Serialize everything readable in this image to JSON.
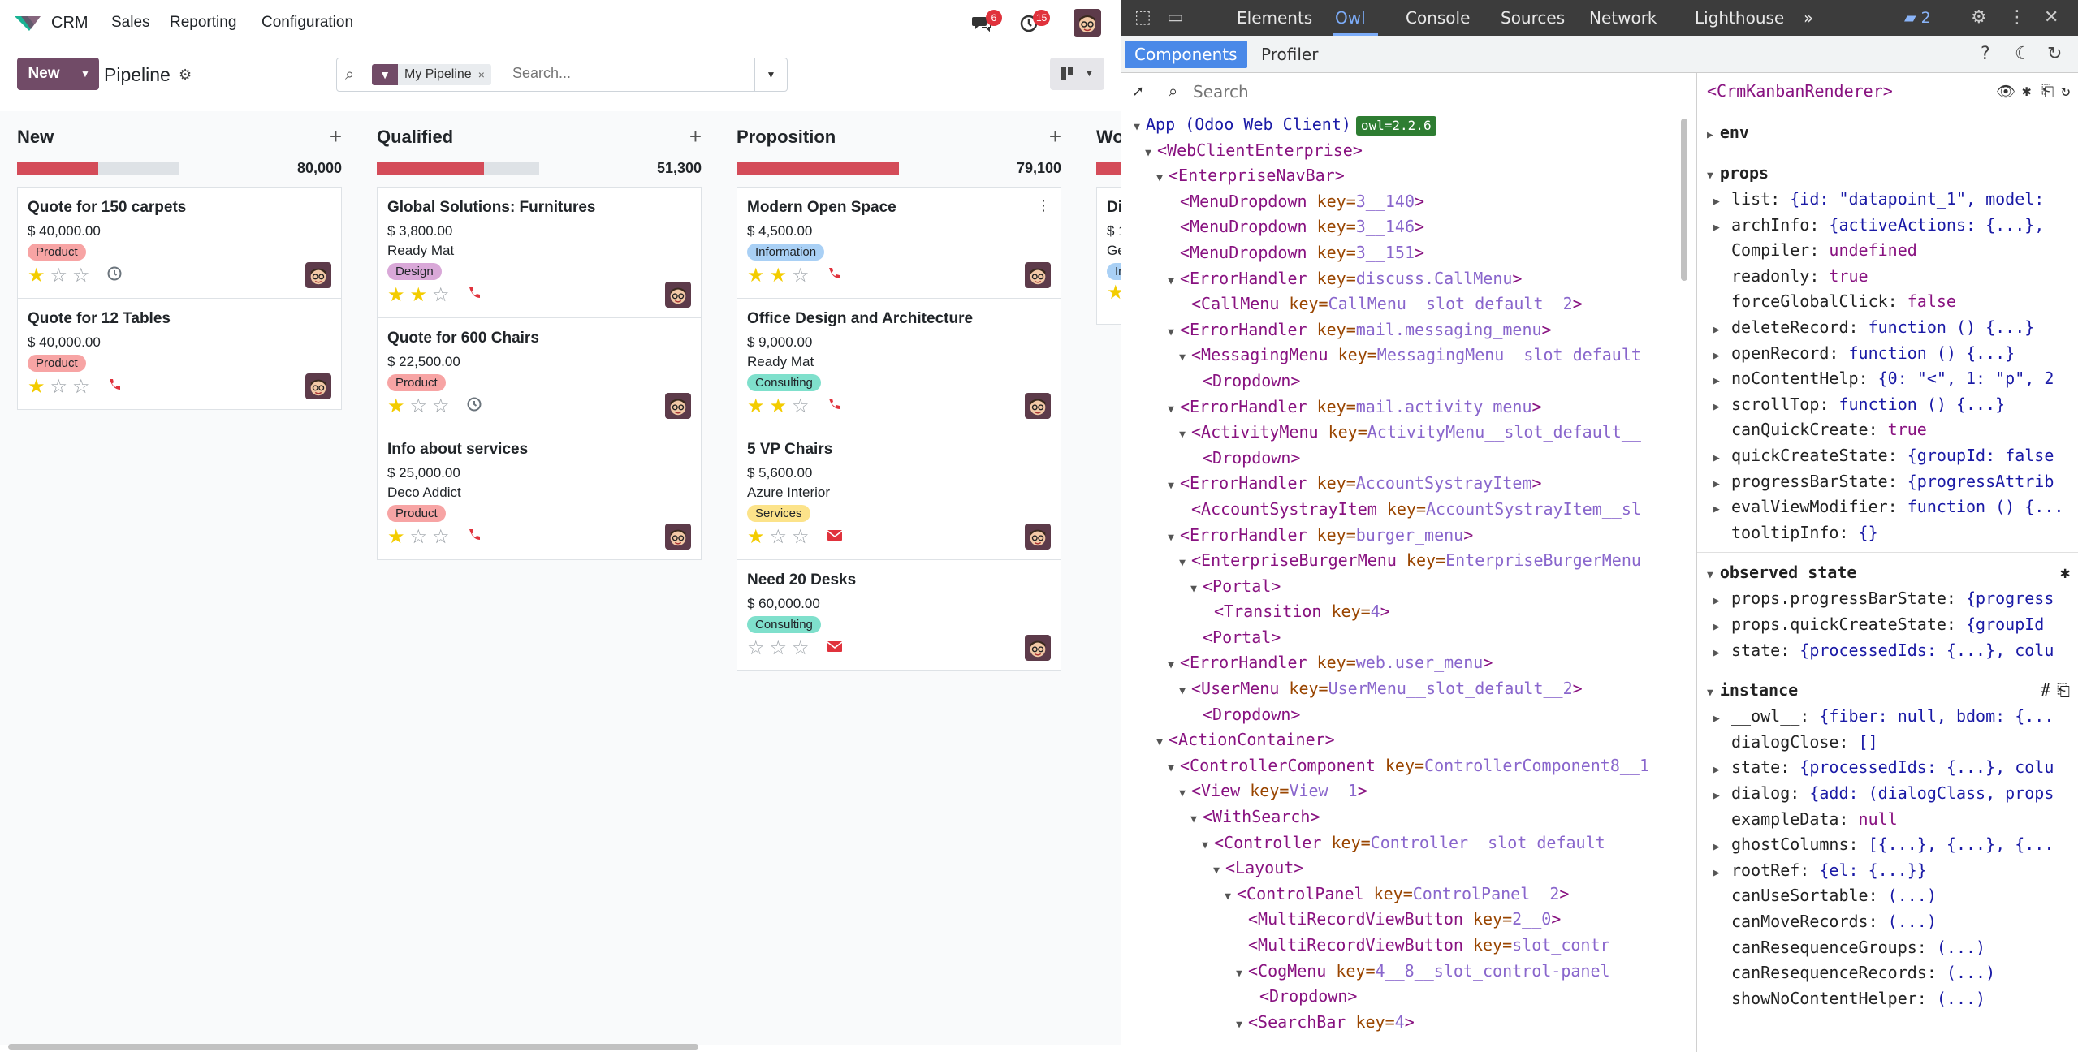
{
  "crm": {
    "app_name": "CRM",
    "menu": [
      "Sales",
      "Reporting",
      "Configuration"
    ],
    "discuss_count": "6",
    "activity_count": "15",
    "new_label": "New",
    "breadcrumb": "Pipeline",
    "facet_label": "My Pipeline",
    "search_placeholder": "Search...",
    "columns": [
      {
        "title": "New",
        "total": "80,000",
        "progress": 0.5,
        "cards": [
          {
            "name": "Quote for 150 carpets",
            "amount": "$ 40,000.00",
            "company": "",
            "tag": "Product",
            "tag_color": "#f7a4a4",
            "stars": 1,
            "activity": "clock"
          },
          {
            "name": "Quote for 12 Tables",
            "amount": "$ 40,000.00",
            "company": "",
            "tag": "Product",
            "tag_color": "#f7a4a4",
            "stars": 1,
            "activity": "phone"
          }
        ]
      },
      {
        "title": "Qualified",
        "total": "51,300",
        "progress": 0.66,
        "cards": [
          {
            "name": "Global Solutions: Furnitures",
            "amount": "$ 3,800.00",
            "company": "Ready Mat",
            "tag": "Design",
            "tag_color": "#d9a8d8",
            "stars": 2,
            "activity": "phone"
          },
          {
            "name": "Quote for 600 Chairs",
            "amount": "$ 22,500.00",
            "company": "",
            "tag": "Product",
            "tag_color": "#f7a4a4",
            "stars": 1,
            "activity": "clock"
          },
          {
            "name": "Info about services",
            "amount": "$ 25,000.00",
            "company": "Deco Addict",
            "tag": "Product",
            "tag_color": "#f7a4a4",
            "stars": 1,
            "activity": "phone"
          }
        ]
      },
      {
        "title": "Proposition",
        "total": "79,100",
        "progress": 1.0,
        "cards": [
          {
            "name": "Modern Open Space",
            "amount": "$ 4,500.00",
            "company": "",
            "tag": "Information",
            "tag_color": "#a9d0f5",
            "stars": 2,
            "activity": "phone"
          },
          {
            "name": "Office Design and Architecture",
            "amount": "$ 9,000.00",
            "company": "Ready Mat",
            "tag": "Consulting",
            "tag_color": "#7fe0cc",
            "stars": 2,
            "activity": "phone"
          },
          {
            "name": "5 VP Chairs",
            "amount": "$ 5,600.00",
            "company": "Azure Interior",
            "tag": "Services",
            "tag_color": "#fce38a",
            "stars": 1,
            "activity": "email"
          },
          {
            "name": "Need 20 Desks",
            "amount": "$ 60,000.00",
            "company": "",
            "tag": "Consulting",
            "tag_color": "#7fe0cc",
            "stars": 0,
            "activity": "email"
          }
        ]
      }
    ],
    "partial_column": {
      "title": "Wo",
      "name": "Di",
      "amount": "$ 1",
      "company": "Ge",
      "tag": "In"
    }
  },
  "devtools": {
    "tabs": [
      "Elements",
      "Owl",
      "Console",
      "Sources",
      "Network",
      "Lighthouse"
    ],
    "active_tab": "Owl",
    "more": "»",
    "message_count": "2",
    "subtabs": [
      "Components",
      "Profiler"
    ],
    "search_placeholder": "Search",
    "tree": [
      {
        "indent": 0,
        "arrow": "▼",
        "name": "App (Odoo Web Client)",
        "key": "",
        "val": "",
        "owl": "owl=2.2.6",
        "plain": true
      },
      {
        "indent": 1,
        "arrow": "▼",
        "name": "<WebClientEnterprise>",
        "key": "",
        "val": ""
      },
      {
        "indent": 2,
        "arrow": "▼",
        "name": "<EnterpriseNavBar>",
        "key": "",
        "val": ""
      },
      {
        "indent": 3,
        "arrow": "",
        "name": "<MenuDropdown",
        "key": " key=",
        "val": "3__140",
        "close": ">"
      },
      {
        "indent": 3,
        "arrow": "",
        "name": "<MenuDropdown",
        "key": " key=",
        "val": "3__146",
        "close": ">"
      },
      {
        "indent": 3,
        "arrow": "",
        "name": "<MenuDropdown",
        "key": " key=",
        "val": "3__151",
        "close": ">"
      },
      {
        "indent": 3,
        "arrow": "▼",
        "name": "<ErrorHandler",
        "key": " key=",
        "val": "discuss.CallMenu",
        "close": ">"
      },
      {
        "indent": 4,
        "arrow": "",
        "name": "<CallMenu",
        "key": " key=",
        "val": "CallMenu__slot_default__2",
        "close": ">"
      },
      {
        "indent": 3,
        "arrow": "▼",
        "name": "<ErrorHandler",
        "key": " key=",
        "val": "mail.messaging_menu",
        "close": ">"
      },
      {
        "indent": 4,
        "arrow": "▼",
        "name": "<MessagingMenu",
        "key": " key=",
        "val": "MessagingMenu__slot_default",
        "close": ""
      },
      {
        "indent": 5,
        "arrow": "",
        "name": "<Dropdown>",
        "key": "",
        "val": ""
      },
      {
        "indent": 3,
        "arrow": "▼",
        "name": "<ErrorHandler",
        "key": " key=",
        "val": "mail.activity_menu",
        "close": ">"
      },
      {
        "indent": 4,
        "arrow": "▼",
        "name": "<ActivityMenu",
        "key": " key=",
        "val": "ActivityMenu__slot_default__",
        "close": ""
      },
      {
        "indent": 5,
        "arrow": "",
        "name": "<Dropdown>",
        "key": "",
        "val": ""
      },
      {
        "indent": 3,
        "arrow": "▼",
        "name": "<ErrorHandler",
        "key": " key=",
        "val": "AccountSystrayItem",
        "close": ">"
      },
      {
        "indent": 4,
        "arrow": "",
        "name": "<AccountSystrayItem",
        "key": " key=",
        "val": "AccountSystrayItem__sl",
        "close": ""
      },
      {
        "indent": 3,
        "arrow": "▼",
        "name": "<ErrorHandler",
        "key": " key=",
        "val": "burger_menu",
        "close": ">"
      },
      {
        "indent": 4,
        "arrow": "▼",
        "name": "<EnterpriseBurgerMenu",
        "key": " key=",
        "val": "EnterpriseBurgerMenu",
        "close": ""
      },
      {
        "indent": 5,
        "arrow": "▼",
        "name": "<Portal>",
        "key": "",
        "val": ""
      },
      {
        "indent": 6,
        "arrow": "",
        "name": "<Transition",
        "key": " key=",
        "val": "4",
        "close": ">"
      },
      {
        "indent": 5,
        "arrow": "",
        "name": "<Portal>",
        "key": "",
        "val": ""
      },
      {
        "indent": 3,
        "arrow": "▼",
        "name": "<ErrorHandler",
        "key": " key=",
        "val": "web.user_menu",
        "close": ">"
      },
      {
        "indent": 4,
        "arrow": "▼",
        "name": "<UserMenu",
        "key": " key=",
        "val": "UserMenu__slot_default__2",
        "close": ">"
      },
      {
        "indent": 5,
        "arrow": "",
        "name": "<Dropdown>",
        "key": "",
        "val": ""
      },
      {
        "indent": 2,
        "arrow": "▼",
        "name": "<ActionContainer>",
        "key": "",
        "val": ""
      },
      {
        "indent": 3,
        "arrow": "▼",
        "name": "<ControllerComponent",
        "key": " key=",
        "val": "ControllerComponent8__1",
        "close": ""
      },
      {
        "indent": 4,
        "arrow": "▼",
        "name": "<View",
        "key": " key=",
        "val": "View__1",
        "close": ">"
      },
      {
        "indent": 5,
        "arrow": "▼",
        "name": "<WithSearch>",
        "key": "",
        "val": ""
      },
      {
        "indent": 6,
        "arrow": "▼",
        "name": "<Controller",
        "key": " key=",
        "val": "Controller__slot_default__",
        "close": ""
      },
      {
        "indent": 7,
        "arrow": "▼",
        "name": "<Layout>",
        "key": "",
        "val": ""
      },
      {
        "indent": 8,
        "arrow": "▼",
        "name": "<ControlPanel",
        "key": " key=",
        "val": "ControlPanel__2",
        "close": ">"
      },
      {
        "indent": 9,
        "arrow": "",
        "name": "<MultiRecordViewButton",
        "key": " key=",
        "val": "2__0",
        "close": ">"
      },
      {
        "indent": 9,
        "arrow": "",
        "name": "<MultiRecordViewButton",
        "key": " key=",
        "val": "slot_contr",
        "close": ""
      },
      {
        "indent": 9,
        "arrow": "▼",
        "name": "<CogMenu",
        "key": " key=",
        "val": "4__8__slot_control-panel",
        "close": ""
      },
      {
        "indent": 10,
        "arrow": "",
        "name": "<Dropdown>",
        "key": "",
        "val": ""
      },
      {
        "indent": 9,
        "arrow": "▼",
        "name": "<SearchBar",
        "key": " key=",
        "val": "4",
        "close": ">"
      }
    ],
    "props_component": "<CrmKanbanRenderer>",
    "sections": [
      {
        "title": "env",
        "open": false,
        "rows": []
      },
      {
        "title": "props",
        "open": true,
        "rows": [
          {
            "arrow": true,
            "key": "list:",
            "val": "{id: \"datapoint_1\", model:",
            "kw": false
          },
          {
            "arrow": true,
            "key": "archInfo:",
            "val": "{activeActions: {...},",
            "kw": false
          },
          {
            "arrow": false,
            "key": "Compiler:",
            "val": "undefined",
            "kw": true
          },
          {
            "arrow": false,
            "key": "readonly:",
            "val": "true",
            "kw": true
          },
          {
            "arrow": false,
            "key": "forceGlobalClick:",
            "val": "false",
            "kw": true
          },
          {
            "arrow": true,
            "key": "deleteRecord:",
            "val": "function () {...}",
            "kw": false
          },
          {
            "arrow": true,
            "key": "openRecord:",
            "val": "function () {...}",
            "kw": false
          },
          {
            "arrow": true,
            "key": "noContentHelp:",
            "val": "{0: \"<\", 1: \"p\", 2",
            "kw": false
          },
          {
            "arrow": true,
            "key": "scrollTop:",
            "val": "function () {...}",
            "kw": false
          },
          {
            "arrow": false,
            "key": "canQuickCreate:",
            "val": "true",
            "kw": true
          },
          {
            "arrow": true,
            "key": "quickCreateState:",
            "val": "{groupId: false",
            "kw": false
          },
          {
            "arrow": true,
            "key": "progressBarState:",
            "val": "{progressAttrib",
            "kw": false
          },
          {
            "arrow": true,
            "key": "evalViewModifier:",
            "val": "function () {...",
            "kw": false
          },
          {
            "arrow": false,
            "key": "tooltipInfo:",
            "val": "{}",
            "kw": false
          }
        ]
      },
      {
        "title": "observed state",
        "open": true,
        "rows": [
          {
            "arrow": true,
            "key": "props.progressBarState:",
            "val": "{progress",
            "kw": false
          },
          {
            "arrow": true,
            "key": "props.quickCreateState:",
            "val": "{groupId",
            "kw": false
          },
          {
            "arrow": true,
            "key": "state:",
            "val": "{processedIds: {...}, colu",
            "kw": false
          }
        ]
      },
      {
        "title": "instance",
        "open": true,
        "rows": [
          {
            "arrow": true,
            "key": "__owl__:",
            "val": "{fiber: null, bdom: {...",
            "kw": false
          },
          {
            "arrow": false,
            "key": "dialogClose:",
            "val": "[]",
            "kw": false
          },
          {
            "arrow": true,
            "key": "state:",
            "val": "{processedIds: {...}, colu",
            "kw": false
          },
          {
            "arrow": true,
            "key": "dialog:",
            "val": "{add: (dialogClass, props",
            "kw": false
          },
          {
            "arrow": false,
            "key": "exampleData:",
            "val": "null",
            "kw": true
          },
          {
            "arrow": true,
            "key": "ghostColumns:",
            "val": "[{...}, {...}, {...",
            "kw": false
          },
          {
            "arrow": true,
            "key": "rootRef:",
            "val": "{el: {...}}",
            "kw": false
          },
          {
            "arrow": false,
            "key": "canUseSortable:",
            "val": "(...)",
            "kw": false
          },
          {
            "arrow": false,
            "key": "canMoveRecords:",
            "val": "(...)",
            "kw": false
          },
          {
            "arrow": false,
            "key": "canResequenceGroups:",
            "val": "(...)",
            "kw": false
          },
          {
            "arrow": false,
            "key": "canResequenceRecords:",
            "val": "(...)",
            "kw": false
          },
          {
            "arrow": false,
            "key": "showNoContentHelper:",
            "val": "(...)",
            "kw": false
          }
        ]
      }
    ]
  }
}
